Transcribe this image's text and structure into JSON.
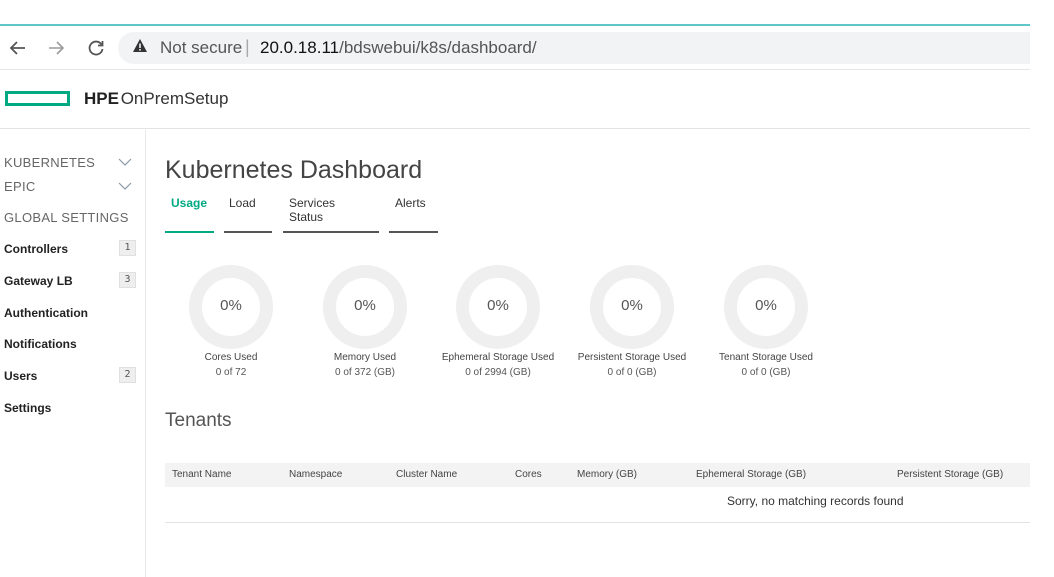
{
  "browser": {
    "not_secure": "Not secure",
    "separator": "|",
    "url_host": "20.0.18.11",
    "url_path": "/bdswebui/k8s/dashboard/",
    "back_icon": "arrow-left-icon",
    "forward_icon": "arrow-right-icon",
    "reload_icon": "reload-icon",
    "warning_icon": "warning-icon"
  },
  "header": {
    "brand_bold": "HPE",
    "brand_rest": "OnPremSetup",
    "accent": "#01a982"
  },
  "sidebar": {
    "sections": [
      {
        "label": "KUBERNETES",
        "icon": "chevron-down-icon"
      },
      {
        "label": "EPIC",
        "icon": "chevron-down-icon"
      },
      {
        "label": "GLOBAL SETTINGS"
      }
    ],
    "items": [
      {
        "label": "Controllers",
        "badge": "1"
      },
      {
        "label": "Gateway LB",
        "badge": "3"
      },
      {
        "label": "Authentication"
      },
      {
        "label": "Notifications"
      },
      {
        "label": "Users",
        "badge": "2"
      },
      {
        "label": "Settings"
      }
    ]
  },
  "main": {
    "title": "Kubernetes Dashboard",
    "tabs": [
      {
        "label": "Usage",
        "active": true
      },
      {
        "label": "Load"
      },
      {
        "label": "Services Status"
      },
      {
        "label": "Alerts"
      }
    ],
    "gauges": [
      {
        "value": "0%",
        "label": "Cores Used",
        "sub": "0 of 72"
      },
      {
        "value": "0%",
        "label": "Memory Used",
        "sub": "0 of 372 (GB)"
      },
      {
        "value": "0%",
        "label": "Ephemeral Storage Used",
        "sub": "0 of 2994 (GB)"
      },
      {
        "value": "0%",
        "label": "Persistent Storage Used",
        "sub": "0 of 0 (GB)"
      },
      {
        "value": "0%",
        "label": "Tenant Storage Used",
        "sub": "0 of 0 (GB)"
      }
    ],
    "tenants": {
      "title": "Tenants",
      "columns": [
        "Tenant Name",
        "Namespace",
        "Cluster Name",
        "Cores",
        "Memory (GB)",
        "Ephemeral Storage (GB)",
        "Persistent Storage (GB)"
      ],
      "empty_message": "Sorry, no matching records found"
    }
  }
}
